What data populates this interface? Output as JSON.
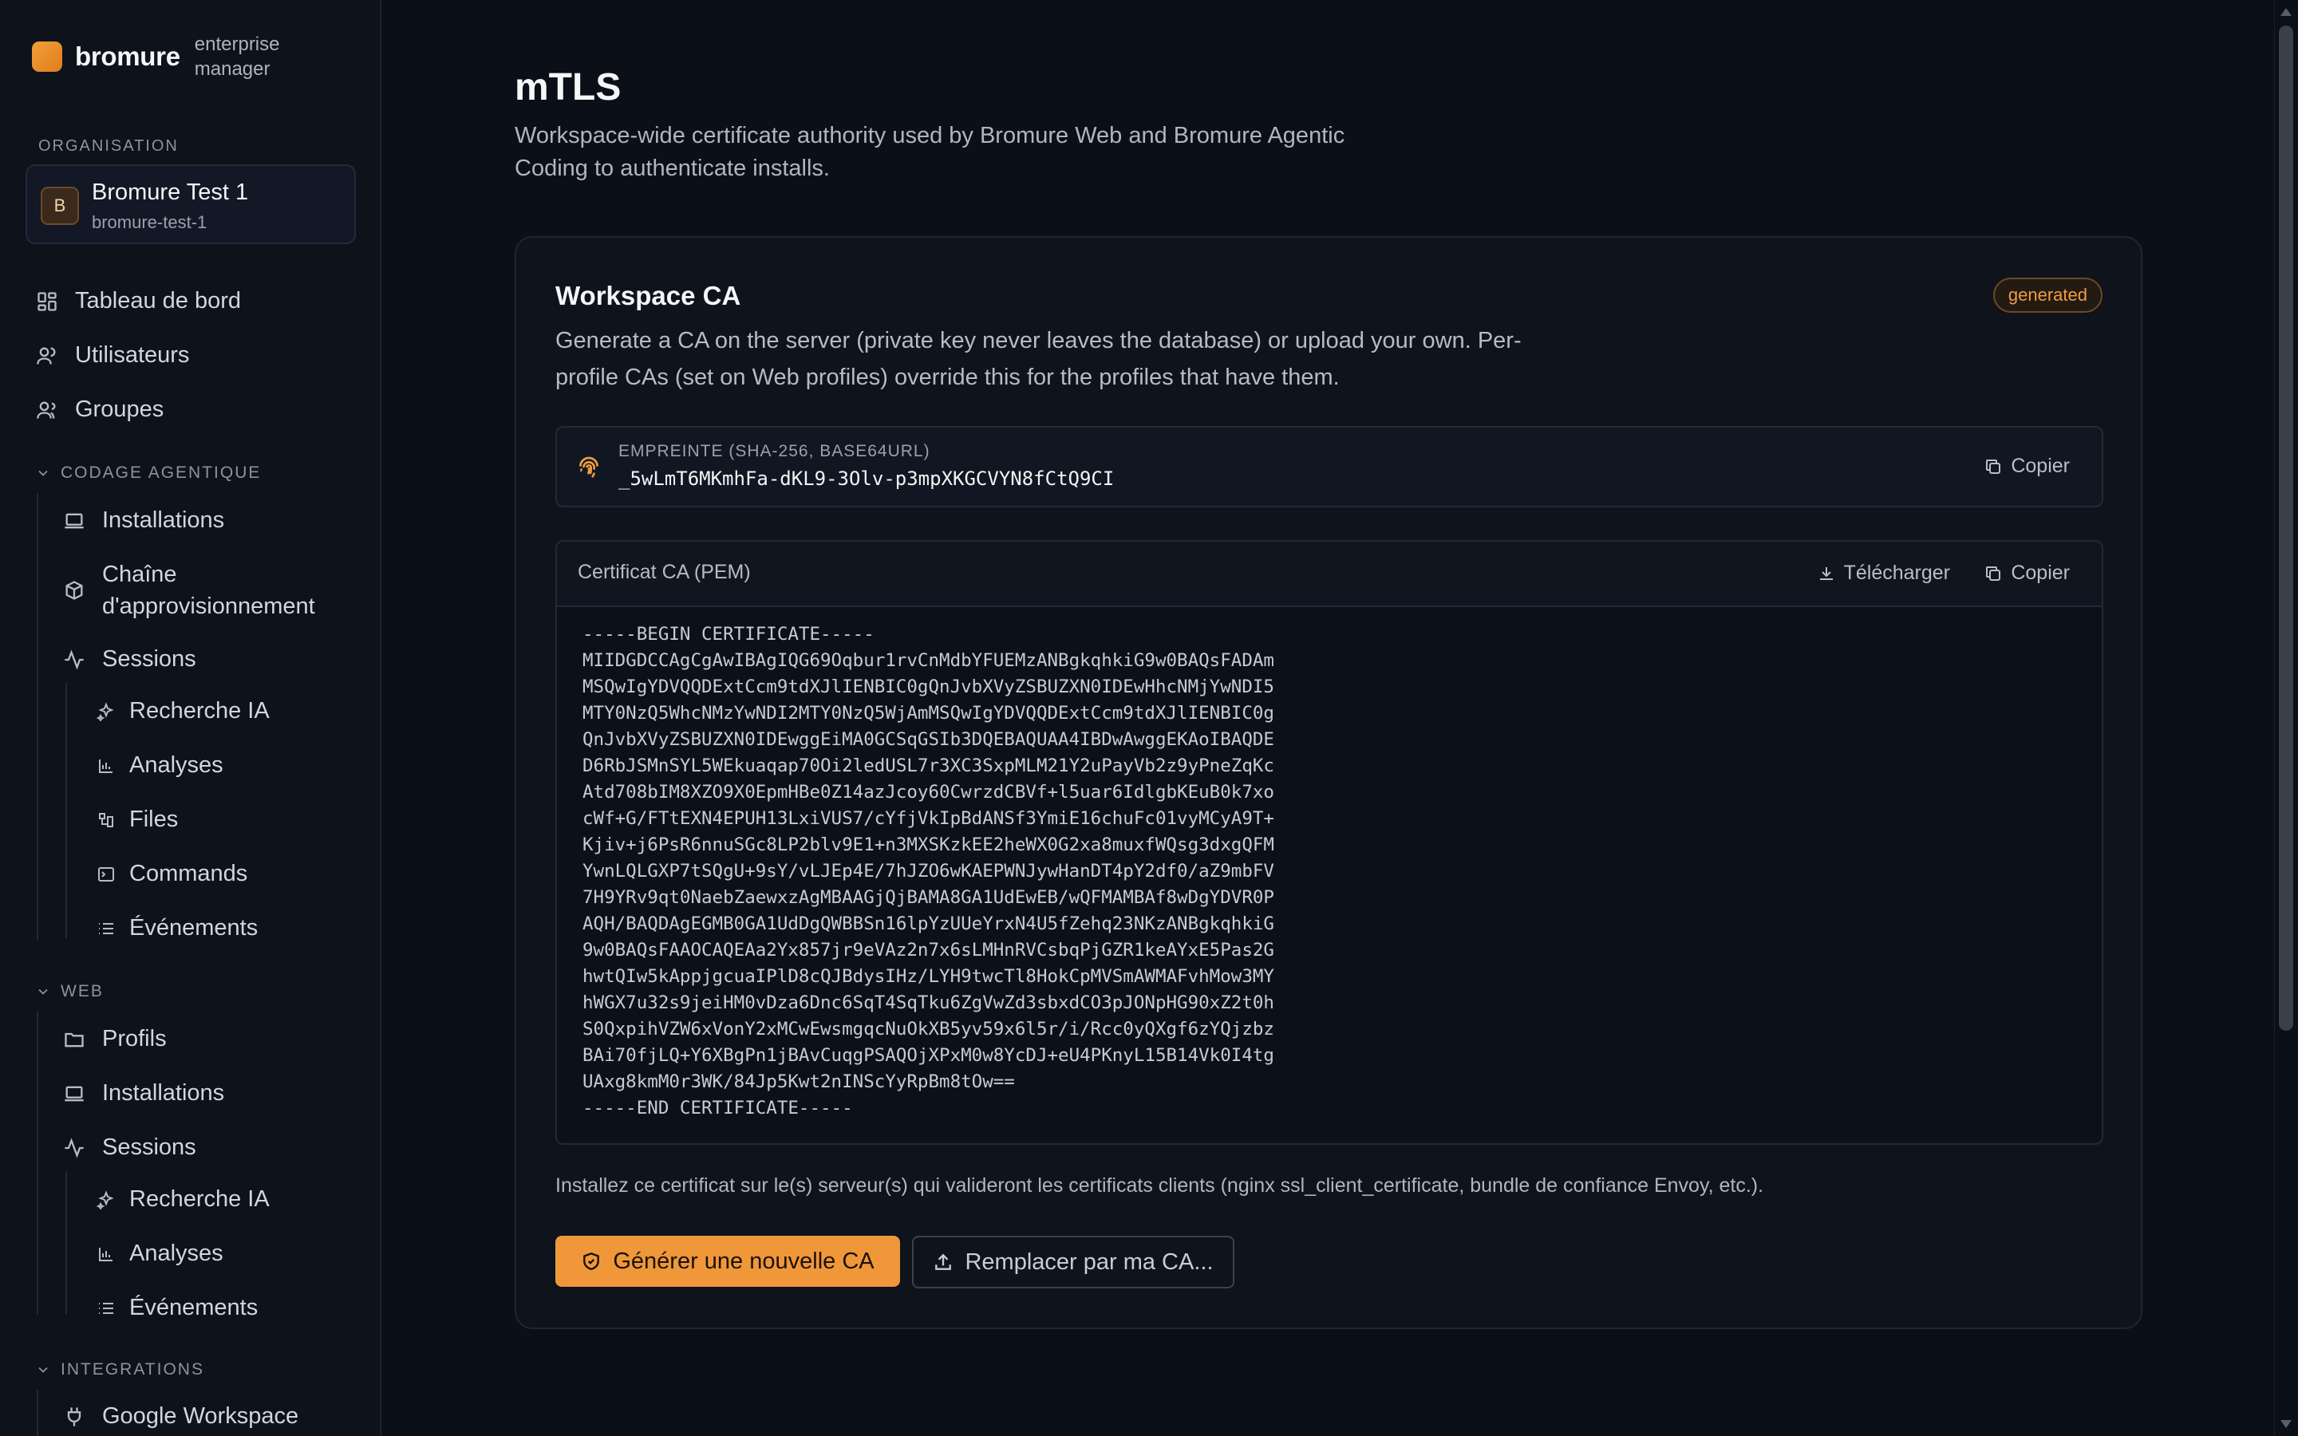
{
  "app": {
    "brand_name": "bromure",
    "brand_sub": "enterprise manager",
    "accent": "#f0973a"
  },
  "sidebar": {
    "org_label": "ORGANISATION",
    "org": {
      "initial": "B",
      "name": "Bromure Test 1",
      "slug": "bromure-test-1"
    },
    "top_items": [
      {
        "label": "Tableau de bord",
        "icon": "dashboard-icon"
      },
      {
        "label": "Utilisateurs",
        "icon": "users-icon"
      },
      {
        "label": "Groupes",
        "icon": "groups-icon"
      }
    ],
    "groups": {
      "coding": {
        "label": "CODAGE AGENTIQUE",
        "items": [
          {
            "label": "Installations",
            "icon": "laptop-icon"
          },
          {
            "label": "Chaîne d'approvisionnement",
            "icon": "package-icon"
          },
          {
            "label": "Sessions",
            "icon": "activity-icon"
          }
        ],
        "sub_items": [
          {
            "label": "Recherche IA",
            "icon": "sparkles-icon"
          },
          {
            "label": "Analyses",
            "icon": "bar-chart-icon"
          },
          {
            "label": "Files",
            "icon": "files-icon"
          },
          {
            "label": "Commands",
            "icon": "terminal-icon"
          },
          {
            "label": "Événements",
            "icon": "list-icon"
          }
        ]
      },
      "web": {
        "label": "WEB",
        "items": [
          {
            "label": "Profils",
            "icon": "folder-icon"
          },
          {
            "label": "Installations",
            "icon": "laptop-icon"
          },
          {
            "label": "Sessions",
            "icon": "activity-icon"
          }
        ],
        "sub_items": [
          {
            "label": "Recherche IA",
            "icon": "sparkles-icon"
          },
          {
            "label": "Analyses",
            "icon": "bar-chart-icon"
          },
          {
            "label": "Événements",
            "icon": "list-icon"
          }
        ]
      },
      "integrations": {
        "label": "INTEGRATIONS",
        "items": [
          {
            "label": "Google Workspace",
            "icon": "plug-icon"
          }
        ]
      }
    }
  },
  "main": {
    "title": "mTLS",
    "description": "Workspace-wide certificate authority used by Bromure Web and Bromure Agentic Coding to authenticate installs.",
    "card": {
      "title": "Workspace CA",
      "badge": "generated",
      "description": "Generate a CA on the server (private key never leaves the database) or upload your own. Per-profile CAs (set on Web profiles) override this for the profiles that have them.",
      "fingerprint": {
        "label": "EMPREINTE (SHA-256, BASE64URL)",
        "value": "_5wLmT6MKmhFa-dKL9-3Olv-p3mpXKGCVYN8fCtQ9CI",
        "copy_label": "Copier"
      },
      "pem": {
        "title": "Certificat CA (PEM)",
        "download_label": "Télécharger",
        "copy_label": "Copier",
        "content": "-----BEGIN CERTIFICATE-----\nMIIDGDCCAgCgAwIBAgIQG69Oqbur1rvCnMdbYFUEMzANBgkqhkiG9w0BAQsFADAm\nMSQwIgYDVQQDExtCcm9tdXJlIENBIC0gQnJvbXVyZSBUZXN0IDEwHhcNMjYwNDI5\nMTY0NzQ5WhcNMzYwNDI2MTY0NzQ5WjAmMSQwIgYDVQQDExtCcm9tdXJlIENBIC0g\nQnJvbXVyZSBUZXN0IDEwggEiMA0GCSqGSIb3DQEBAQUAA4IBDwAwggEKAoIBAQDE\nD6RbJSMnSYL5WEkuaqap70Oi2ledUSL7r3XC3SxpMLM21Y2uPayVb2z9yPneZqKc\nAtd708bIM8XZO9X0EpmHBe0Z14azJcoy60CwrzdCBVf+l5uar6IdlgbKEuB0k7xo\ncWf+G/FTtEXN4EPUH13LxiVUS7/cYfjVkIpBdANSf3YmiE16chuFc01vyMCyA9T+\nKjiv+j6PsR6nnuSGc8LP2blv9E1+n3MXSKzkEE2heWX0G2xa8muxfWQsg3dxgQFM\nYwnLQLGXP7tSQgU+9sY/vLJEp4E/7hJZO6wKAEPWNJywHanDT4pY2df0/aZ9mbFV\n7H9YRv9qt0NaebZaewxzAgMBAAGjQjBAMA8GA1UdEwEB/wQFMAMBAf8wDgYDVR0P\nAQH/BAQDAgEGMB0GA1UdDgQWBBSn16lpYzUUeYrxN4U5fZehq23NKzANBgkqhkiG\n9w0BAQsFAAOCAQEAa2Yx857jr9eVAz2n7x6sLMHnRVCsbqPjGZR1keAYxE5Pas2G\nhwtQIw5kAppjgcuaIPlD8cQJBdysIHz/LYH9twcTl8HokCpMVSmAWMAFvhMow3MY\nhWGX7u32s9jeiHM0vDza6Dnc6SqT4SqTku6ZgVwZd3sbxdCO3pJONpHG90xZ2t0h\nS0QxpihVZW6xVonY2xMCwEwsmgqcNuOkXB5yv59x6l5r/i/Rcc0yQXgf6zYQjzbz\nBAi70fjLQ+Y6XBgPn1jBAvCuqgPSAQOjXPxM0w8YcDJ+eU4PKnyL15B14Vk0I4tg\nUAxg8kmM0r3WK/84Jp5Kwt2nINScYyRpBm8tOw==\n-----END CERTIFICATE-----"
      },
      "install_note": "Installez ce certificat sur le(s) serveur(s) qui valideront les certificats clients (nginx ssl_client_certificate, bundle de confiance Envoy, etc.).",
      "primary_button": "Générer une nouvelle CA",
      "secondary_button": "Remplacer par ma CA..."
    }
  }
}
